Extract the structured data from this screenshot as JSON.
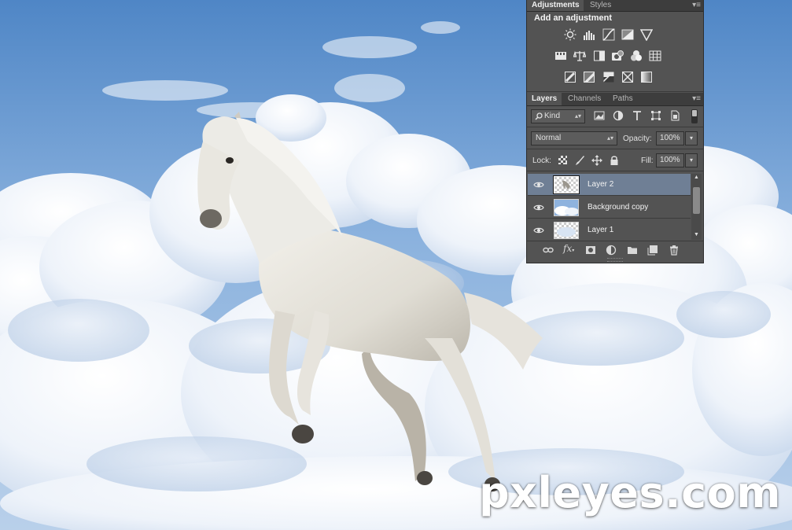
{
  "watermark": "pxleyes.com",
  "adjustments_panel": {
    "tabs": [
      "Adjustments",
      "Styles"
    ],
    "title": "Add an adjustment",
    "icons_row1": [
      "brightness-contrast-icon",
      "levels-icon",
      "curves-icon",
      "exposure-icon",
      "vibrance-icon"
    ],
    "icons_row2": [
      "hue-saturation-icon",
      "color-balance-icon",
      "black-white-icon",
      "photo-filter-icon",
      "channel-mixer-icon",
      "color-lookup-icon"
    ],
    "icons_row3": [
      "invert-icon",
      "posterize-icon",
      "threshold-icon",
      "selective-color-icon",
      "gradient-map-icon"
    ]
  },
  "layers_panel": {
    "tabs": [
      "Layers",
      "Channels",
      "Paths"
    ],
    "filter_kind": "Kind",
    "blend_mode": "Normal",
    "opacity_label": "Opacity:",
    "opacity_value": "100%",
    "lock_label": "Lock:",
    "fill_label": "Fill:",
    "fill_value": "100%",
    "layers": [
      {
        "name": "Layer 2",
        "selected": true,
        "visible": true
      },
      {
        "name": "Background copy",
        "selected": false,
        "visible": true
      },
      {
        "name": "Layer 1",
        "selected": false,
        "visible": true
      }
    ]
  },
  "colors": {
    "panel_bg": "#535353",
    "tab_bar": "#3d3d3d",
    "selected_row": "#6f7f95",
    "sky_top": "#5f93cf",
    "sky_bottom": "#a9c6e6"
  }
}
